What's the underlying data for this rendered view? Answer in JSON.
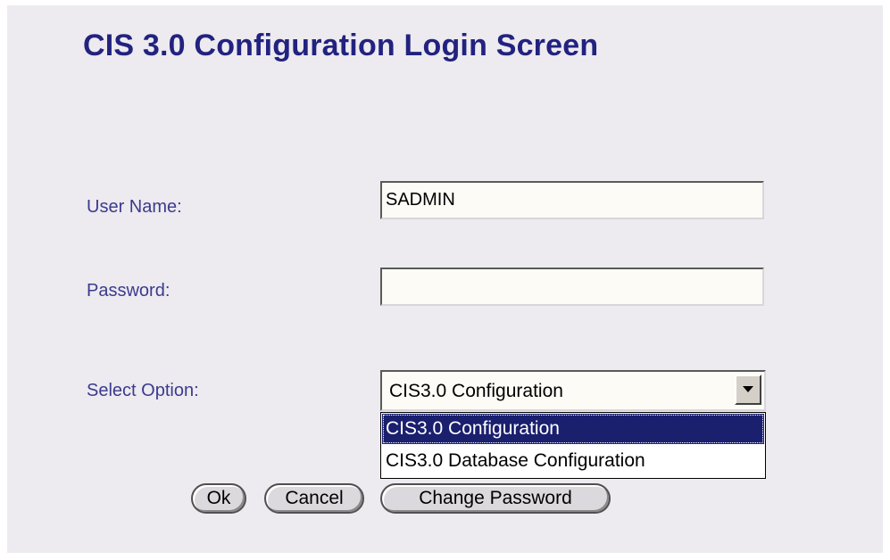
{
  "page": {
    "title": "CIS 3.0 Configuration Login Screen"
  },
  "form": {
    "username_label": "User Name:",
    "username_value": "SADMIN",
    "password_label": "Password:",
    "password_value": "",
    "select_label": "Select Option:",
    "select_value": "CIS3.0 Configuration",
    "options": [
      "CIS3.0 Configuration",
      "CIS3.0 Database Configuration"
    ],
    "selected_option_index": 0
  },
  "buttons": {
    "ok_label": "Ok",
    "cancel_label": "Cancel",
    "change_password_label": "Change Password"
  },
  "colors": {
    "panel_background": "#edeaf0",
    "title_color": "#22227f",
    "label_color": "#3b3b8c",
    "selection_highlight": "#1a1f6e"
  },
  "icons": {
    "dropdown_arrow": "chevron-down-icon"
  }
}
